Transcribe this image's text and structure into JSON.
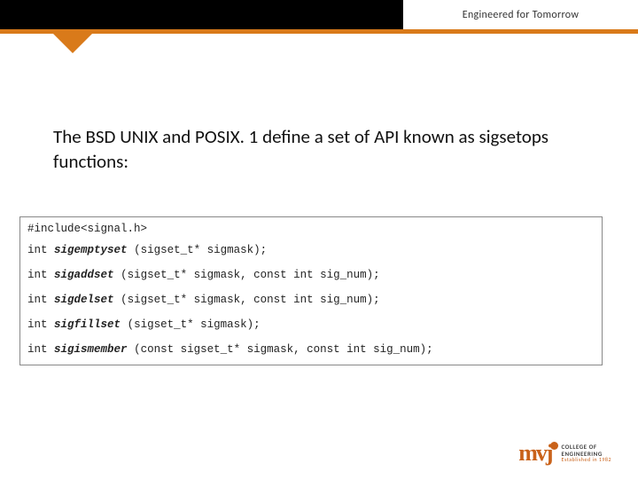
{
  "header": {
    "tagline": "Engineered for Tomorrow"
  },
  "content": {
    "intro": "The BSD UNIX and POSIX. 1 define a set of API known as sigsetops functions:"
  },
  "code": {
    "include": "#include<signal.h>",
    "lines": [
      {
        "ret": "int",
        "name": "sigemptyset",
        "args": "(sigset_t* sigmask);"
      },
      {
        "ret": "int",
        "name": "sigaddset",
        "args": "(sigset_t* sigmask, const int sig_num);"
      },
      {
        "ret": "int",
        "name": "sigdelset",
        "args": "(sigset_t* sigmask, const int sig_num);"
      },
      {
        "ret": "int",
        "name": "sigfillset",
        "args": "(sigset_t* sigmask);"
      },
      {
        "ret": "int",
        "name": "sigismember",
        "args": "(const sigset_t* sigmask, const int sig_num);"
      }
    ]
  },
  "logo": {
    "mark": "mvj",
    "line1": "COLLEGE OF",
    "line2": "ENGINEERING",
    "line3": "Established in 1982"
  }
}
